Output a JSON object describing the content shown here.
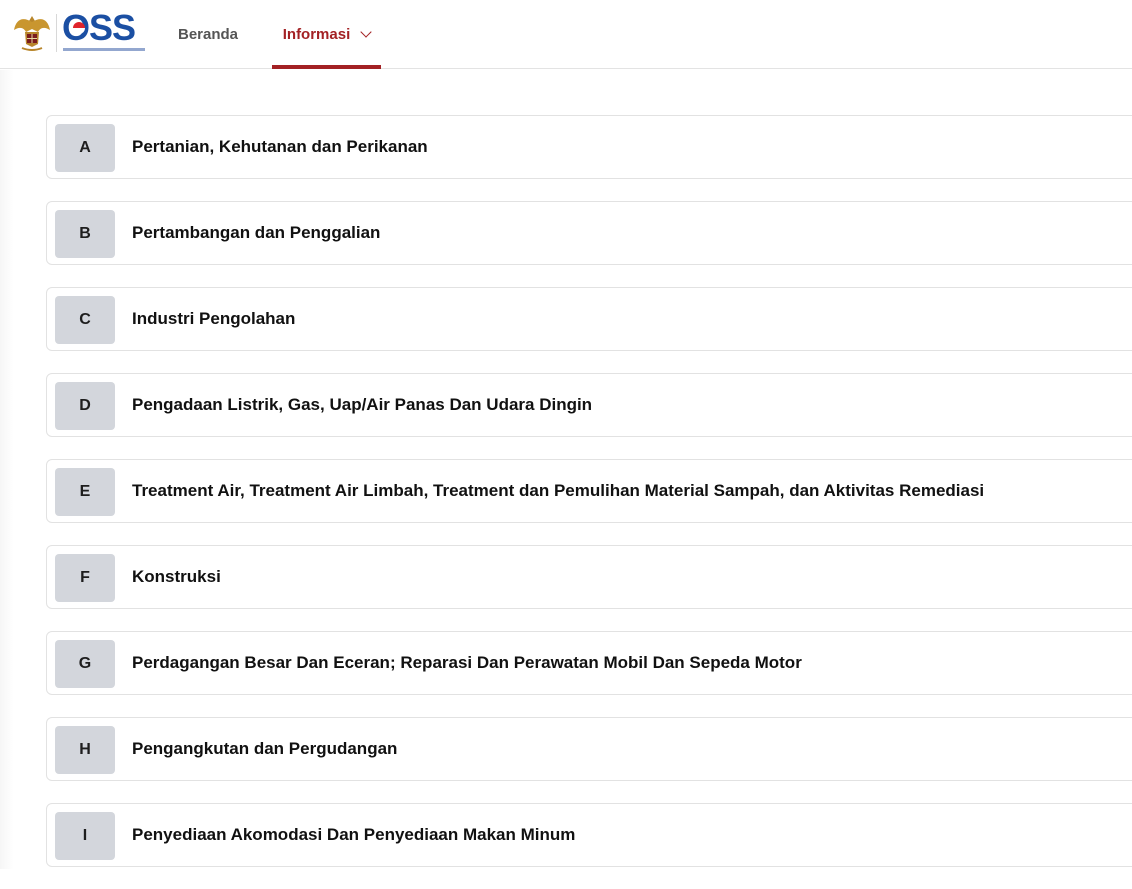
{
  "nav": {
    "home": "Beranda",
    "informasi": "Informasi"
  },
  "colors": {
    "accent": "#a32124",
    "brand_blue": "#1b4fa3",
    "letter_box": "#d3d6dc"
  },
  "logo": {
    "wordmark": "OSS",
    "emblem_icon": "garuda-pancasila-icon"
  },
  "sectors": [
    {
      "code": "A",
      "name": "Pertanian, Kehutanan dan Perikanan"
    },
    {
      "code": "B",
      "name": "Pertambangan dan Penggalian"
    },
    {
      "code": "C",
      "name": "Industri Pengolahan"
    },
    {
      "code": "D",
      "name": "Pengadaan Listrik, Gas, Uap/Air Panas Dan Udara Dingin"
    },
    {
      "code": "E",
      "name": "Treatment Air, Treatment Air Limbah, Treatment dan Pemulihan Material Sampah, dan Aktivitas Remediasi"
    },
    {
      "code": "F",
      "name": "Konstruksi"
    },
    {
      "code": "G",
      "name": "Perdagangan Besar Dan Eceran; Reparasi Dan Perawatan Mobil Dan Sepeda Motor"
    },
    {
      "code": "H",
      "name": "Pengangkutan dan Pergudangan"
    },
    {
      "code": "I",
      "name": "Penyediaan Akomodasi Dan Penyediaan Makan Minum"
    }
  ]
}
